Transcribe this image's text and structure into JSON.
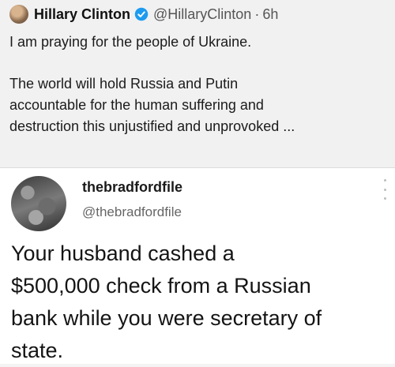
{
  "quoted_tweet": {
    "author_name": "Hillary Clinton",
    "handle": "@HillaryClinton",
    "separator": "·",
    "time": "6h",
    "paragraph1": "I am praying for the people of Ukraine.",
    "paragraph2_lines": [
      "The world will hold Russia and Putin",
      "accountable for the human suffering and",
      "destruction this unjustified and unprovoked ..."
    ],
    "verified_icon": "verified-badge-icon",
    "verified_color": "#1d9bf0"
  },
  "reply": {
    "author_name": "thebradfordfile",
    "handle": "@thebradfordfile",
    "text_lines": [
      "Your husband cashed a",
      "$500,000 check from a Russian",
      "bank while you were secretary of",
      "state."
    ],
    "more_icon": "vertical-ellipsis-icon"
  }
}
